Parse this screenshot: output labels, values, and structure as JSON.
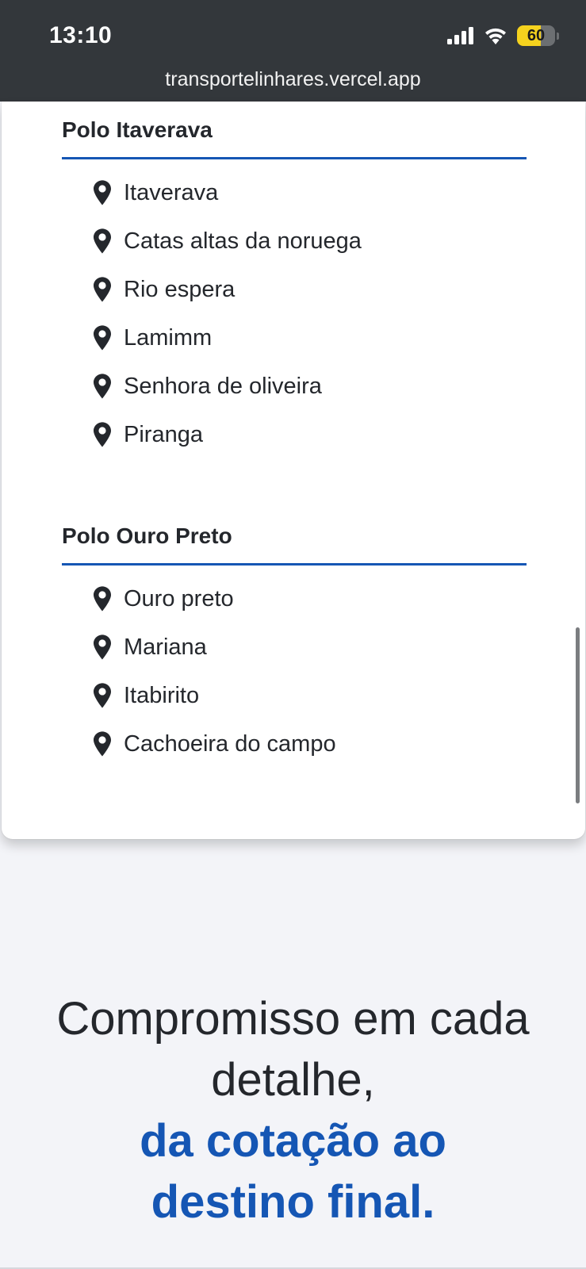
{
  "status_bar": {
    "time": "13:10",
    "battery": "60",
    "url": "transportelinhares.vercel.app"
  },
  "polos": [
    {
      "title": "Polo Itaverava",
      "cities": [
        "Itaverava",
        "Catas altas da noruega",
        "Rio espera",
        "Lamimm",
        "Senhora de oliveira",
        "Piranga"
      ]
    },
    {
      "title": "Polo Ouro Preto",
      "cities": [
        "Ouro preto",
        "Mariana",
        "Itabirito",
        "Cachoeira do campo"
      ]
    }
  ],
  "headline": {
    "line1": "Compromisso em cada",
    "line2": "detalhe,",
    "line3": "da cotação ao",
    "line4": "destino final."
  },
  "colors": {
    "accent": "#1556b4",
    "status_bar": "#33373b",
    "battery": "#f5d21e",
    "background": "#f3f4f8"
  },
  "icons": {
    "list_marker": "map-pin-icon"
  }
}
